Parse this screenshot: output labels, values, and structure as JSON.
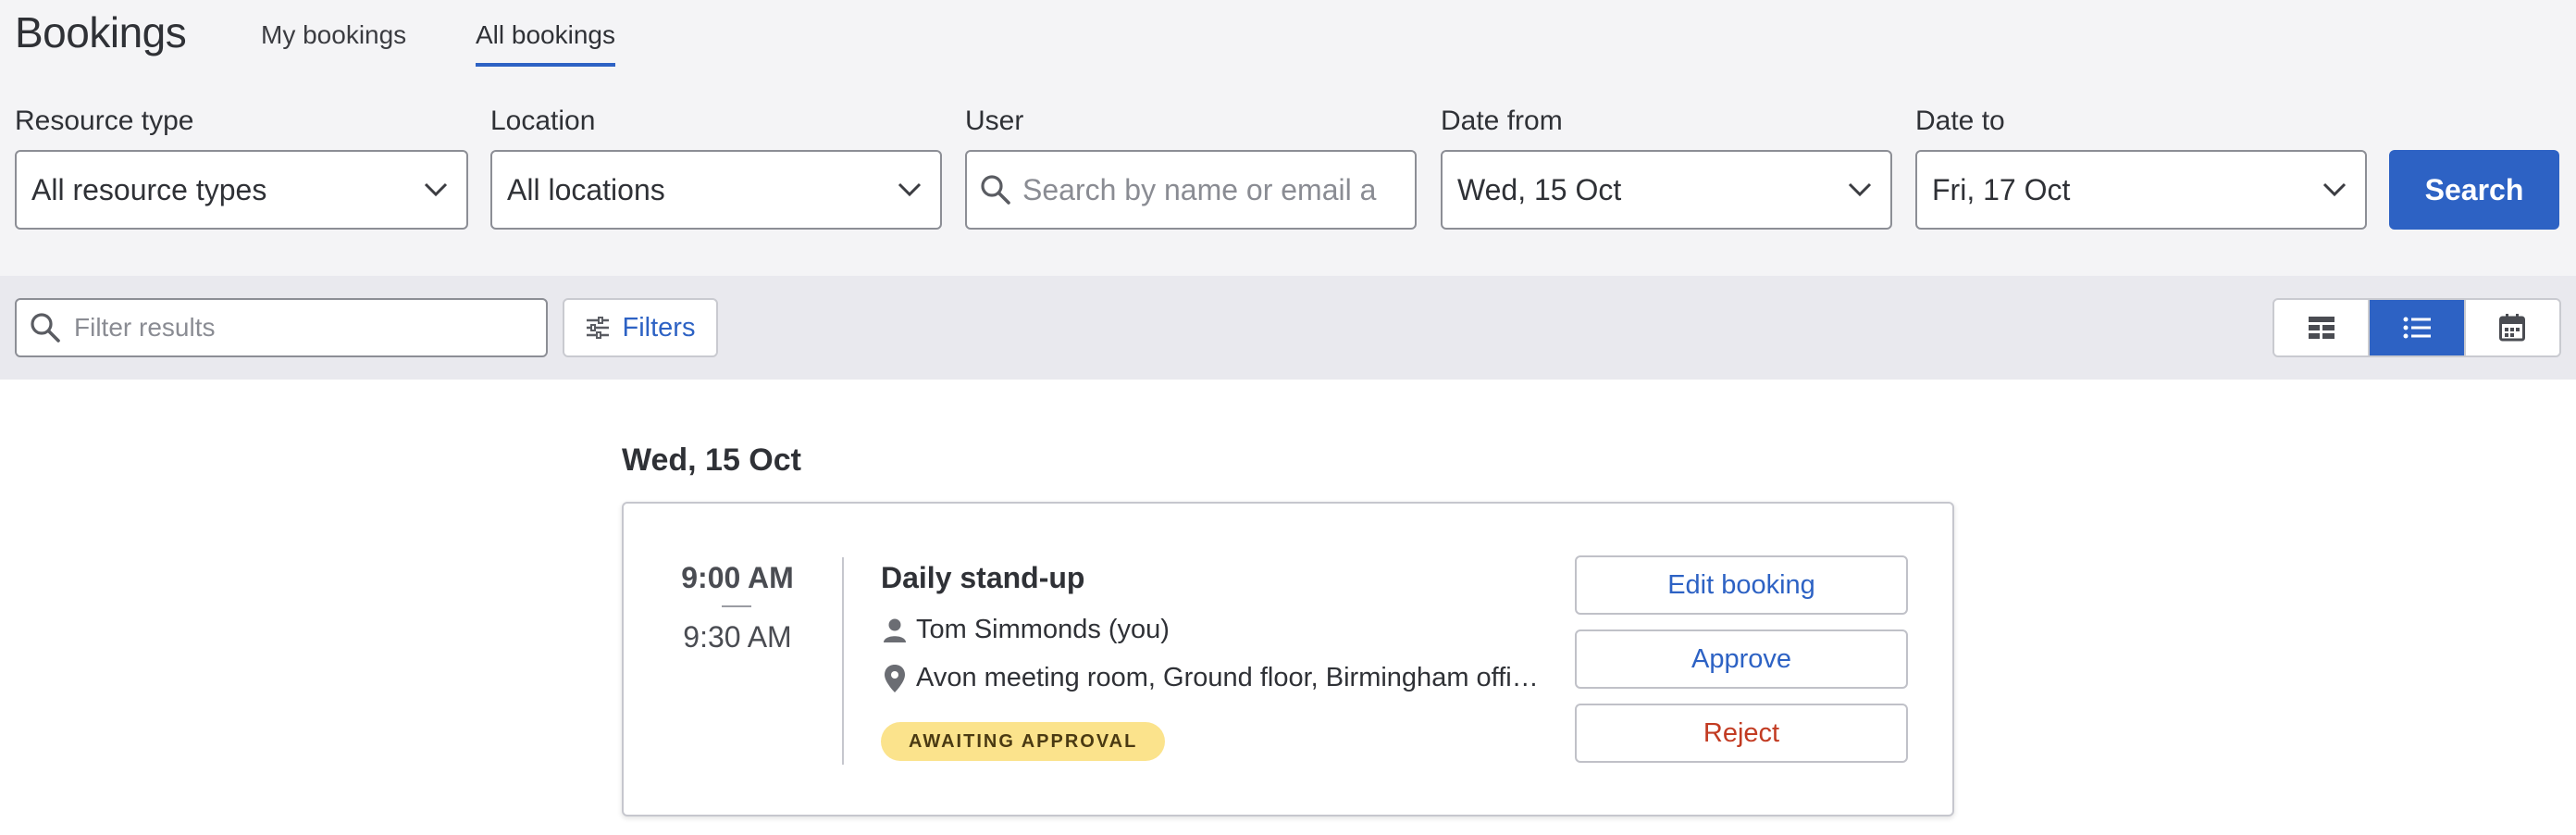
{
  "header": {
    "title": "Bookings",
    "tabs": [
      {
        "label": "My bookings",
        "active": false
      },
      {
        "label": "All bookings",
        "active": true
      }
    ]
  },
  "search_form": {
    "resource_type": {
      "label": "Resource type",
      "value": "All resource types"
    },
    "location": {
      "label": "Location",
      "value": "All locations"
    },
    "user": {
      "label": "User",
      "placeholder": "Search by name or email a"
    },
    "date_from": {
      "label": "Date from",
      "value": "Wed, 15 Oct"
    },
    "date_to": {
      "label": "Date to",
      "value": "Fri, 17 Oct"
    },
    "search_label": "Search"
  },
  "toolbar": {
    "filter_placeholder": "Filter results",
    "filters_label": "Filters",
    "views": [
      {
        "icon": "table-view-icon",
        "active": false
      },
      {
        "icon": "list-view-icon",
        "active": true
      },
      {
        "icon": "calendar-view-icon",
        "active": false
      }
    ]
  },
  "results": {
    "day_heading": "Wed, 15 Oct",
    "booking": {
      "start": "9:00 AM",
      "end": "9:30 AM",
      "title": "Daily stand-up",
      "user": "Tom Simmonds (you)",
      "location": "Avon meeting room, Ground floor, Birmingham offi…",
      "status": "AWAITING APPROVAL",
      "actions": {
        "edit": "Edit booking",
        "approve": "Approve",
        "reject": "Reject"
      }
    }
  },
  "colors": {
    "accent": "#2d62c4",
    "reject": "#c23b22",
    "badge_bg": "#fbe38c",
    "header_bg": "#f4f4f6",
    "toolbar_bg": "#e9e9ee"
  }
}
